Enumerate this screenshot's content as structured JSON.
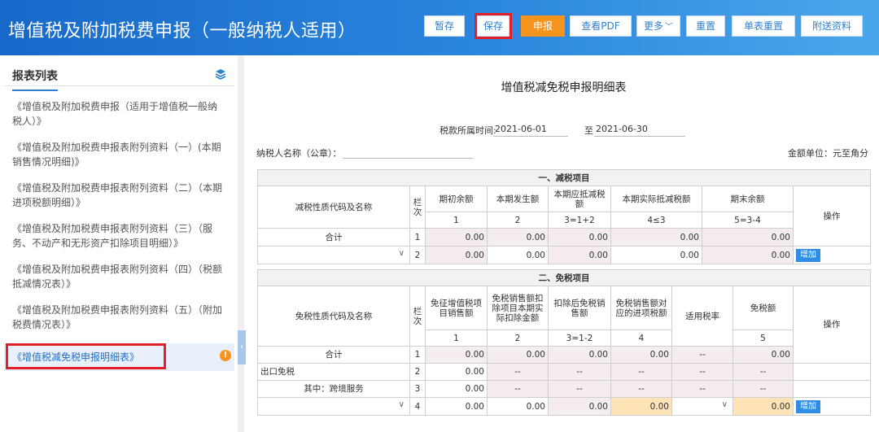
{
  "header": {
    "title": "增值税及附加税费申报（一般纳税人适用）",
    "buttons": [
      "暂存",
      "保存",
      "申报",
      "查看PDF",
      "更多",
      "重置",
      "单表重置",
      "附送资料"
    ]
  },
  "sidebar": {
    "title": "报表列表",
    "items": [
      "《增值税及附加税费申报（适用于增值税一般纳税人）》",
      "《增值税及附加税费申报表附列资料（一）(本期销售情况明细)》",
      "《增值税及附加税费申报表附列资料（二）（本期进项税额明细）》",
      "《增值税及附加税费申报表附列资料（三）（服务、不动产和无形资产扣除项目明细）》",
      "《增值税及附加税费申报表附列资料（四）（税额抵减情况表）》",
      "《增值税及附加税费申报表附列资料（五）（附加税费情况表）》",
      "《增值税减免税申报明细表》"
    ],
    "active_badge": "!"
  },
  "form": {
    "title": "增值税减免税申报明细表",
    "period_label": "税款所属时间:",
    "period_from": "2021-06-01",
    "period_to_label": "至",
    "period_to": "2021-06-30",
    "taxpayer_label": "纳税人名称（公章）：",
    "unit": "金额单位：元至角分"
  },
  "sec1": {
    "title": "一、减税项目",
    "h_name": "减税性质代码及名称",
    "h_col": "栏次",
    "h": [
      "期初余额",
      "本期发生额",
      "本期应抵减税额",
      "本期实际抵减税额",
      "期末余额"
    ],
    "idx": [
      "1",
      "2",
      "3=1+2",
      "4≤3",
      "5=3-4"
    ],
    "h_op": "操作",
    "rows": [
      {
        "name": "合计",
        "no": "1",
        "v": [
          "0.00",
          "0.00",
          "0.00",
          "0.00",
          "0.00"
        ]
      },
      {
        "name": "",
        "no": "2",
        "v": [
          "0.00",
          "0.00",
          "0.00",
          "0.00",
          "0.00"
        ],
        "op": "增加"
      }
    ]
  },
  "sec2": {
    "title": "二、免税项目",
    "h_name": "免税性质代码及名称",
    "h_col": "栏次",
    "h": [
      "免征增值税项目销售额",
      "免税销售额扣除项目本期实际扣除金额",
      "扣除后免税销售额",
      "免税销售额对应的进项税额",
      "适用税率",
      "免税额"
    ],
    "idx": [
      "1",
      "2",
      "3=1-2",
      "4",
      "",
      "5"
    ],
    "h_op": "操作",
    "rows": [
      {
        "name": "合计",
        "no": "1",
        "v": [
          "0.00",
          "0.00",
          "0.00",
          "0.00",
          "--",
          "0.00"
        ]
      },
      {
        "name": "出口免税",
        "no": "2",
        "v": [
          "0.00",
          "--",
          "--",
          "--",
          "--",
          "--"
        ]
      },
      {
        "name": "其中：跨境服务",
        "no": "3",
        "v": [
          "0.00",
          "--",
          "--",
          "--",
          "--",
          "--"
        ]
      },
      {
        "name": "",
        "no": "4",
        "v": [
          "0.00",
          "0.00",
          "0.00",
          "0.00",
          "",
          "0.00"
        ],
        "op": "增加"
      }
    ]
  },
  "colors": {
    "header_from": "#1769c9",
    "header_to": "#4aa7ea",
    "accent": "#2f7fd1",
    "primary": "#f7941d",
    "highlight_box": "#e0202a"
  },
  "icons": [
    "layers-icon",
    "chevron-down-icon",
    "chevron-left-icon",
    "warning-icon"
  ]
}
